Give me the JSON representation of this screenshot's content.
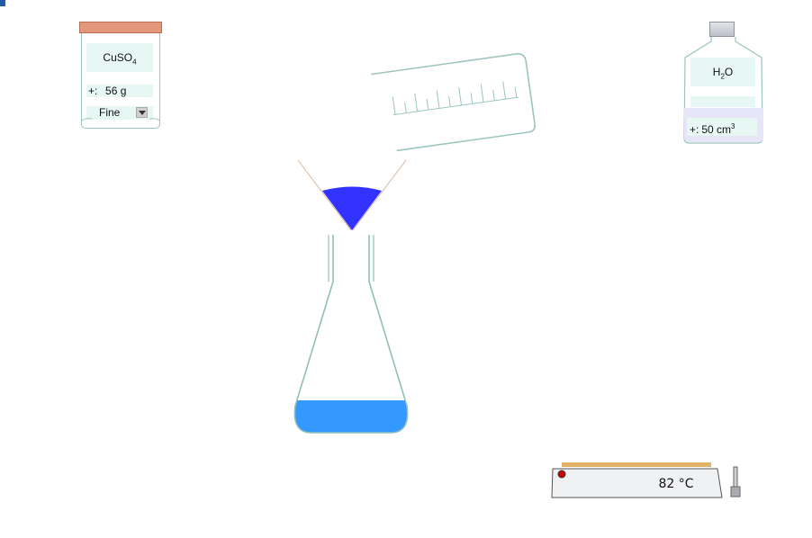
{
  "reagent_jar": {
    "formula_main": "CuSO",
    "formula_sub": "4",
    "amount_prefix": "+:",
    "amount_value": "56 g",
    "grain_size": "Fine",
    "lid_color": "#e3977a"
  },
  "water_bottle": {
    "formula_main": "H",
    "formula_sub": "2",
    "formula_end": "O",
    "amount_prefix": "+:",
    "amount_value": "50 cm",
    "amount_exp": "3"
  },
  "heater": {
    "temperature": "82 °C",
    "plate_color": "#e1b165",
    "indicator_color": "#cc0000"
  },
  "flask": {
    "liquid_color": "#3399ff"
  },
  "funnel": {
    "filter_color": "#3333ff"
  },
  "cylinder": {
    "tick_count": 12
  }
}
